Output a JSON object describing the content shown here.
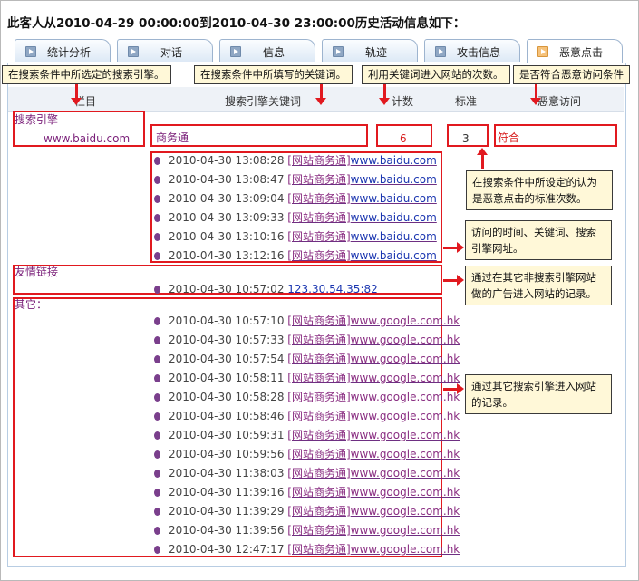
{
  "header": {
    "title": "此客人从2010-04-29 00:00:00到2010-04-30 23:00:00历史活动信息如下："
  },
  "tabs": [
    {
      "label": "统计分析"
    },
    {
      "label": "对话"
    },
    {
      "label": "信息"
    },
    {
      "label": "轨迹"
    },
    {
      "label": "攻击信息"
    },
    {
      "label": "恶意点击",
      "active": true
    }
  ],
  "columns": {
    "c1": "栏目",
    "c2": "搜索引擎关键词",
    "c3": "计数",
    "c4": "标准",
    "c5": "恶意访问"
  },
  "annotations": {
    "engine": "在搜索条件中所选定的搜索引擎。",
    "keyword": "在搜索条件中所填写的关键词。",
    "count": "利用关键词进入网站的次数。",
    "malicious": "是否符合恶意访问条件",
    "standard": "在搜索条件中所设定的认为是恶意点击的标准次数。",
    "visits": "访问的时间、关键词、搜索引擎网址。",
    "friend": "通过在其它非搜索引擎网站做的广告进入网站的记录。",
    "other": "通过其它搜索引擎进入网站的记录。"
  },
  "search_section": {
    "label": "搜索引擎",
    "engine": "www.baidu.com",
    "keyword": "商务通",
    "count": "6",
    "standard": "3",
    "malicious": "符合",
    "records": [
      {
        "time": "2010-04-30 13:08:28",
        "kw": "[网站商务通]",
        "url": "www.baidu.com"
      },
      {
        "time": "2010-04-30 13:08:47",
        "kw": "[网站商务通]",
        "url": "www.baidu.com"
      },
      {
        "time": "2010-04-30 13:09:04",
        "kw": "[网站商务通]",
        "url": "www.baidu.com"
      },
      {
        "time": "2010-04-30 13:09:33",
        "kw": "[网站商务通]",
        "url": "www.baidu.com"
      },
      {
        "time": "2010-04-30 13:10:16",
        "kw": "[网站商务通]",
        "url": "www.baidu.com"
      },
      {
        "time": "2010-04-30 13:12:16",
        "kw": "[网站商务通]",
        "url": "www.baidu.com"
      }
    ]
  },
  "friend_section": {
    "label": "友情链接",
    "records": [
      {
        "time": "2010-04-30 10:57:02",
        "url": "123.30.54.35:82"
      }
    ]
  },
  "other_section": {
    "label": "其它：",
    "records": [
      {
        "time": "2010-04-30 10:57:10",
        "kw": "[网站商务通]",
        "url": "www.google.com.hk"
      },
      {
        "time": "2010-04-30 10:57:33",
        "kw": "[网站商务通]",
        "url": "www.google.com.hk"
      },
      {
        "time": "2010-04-30 10:57:54",
        "kw": "[网站商务通]",
        "url": "www.google.com.hk"
      },
      {
        "time": "2010-04-30 10:58:11",
        "kw": "[网站商务通]",
        "url": "www.google.com.hk"
      },
      {
        "time": "2010-04-30 10:58:28",
        "kw": "[网站商务通]",
        "url": "www.google.com.hk"
      },
      {
        "time": "2010-04-30 10:58:46",
        "kw": "[网站商务通]",
        "url": "www.google.com.hk"
      },
      {
        "time": "2010-04-30 10:59:31",
        "kw": "[网站商务通]",
        "url": "www.google.com.hk"
      },
      {
        "time": "2010-04-30 10:59:56",
        "kw": "[网站商务通]",
        "url": "www.google.com.hk"
      },
      {
        "time": "2010-04-30 11:38:03",
        "kw": "[网站商务通]",
        "url": "www.google.com.hk"
      },
      {
        "time": "2010-04-30 11:39:16",
        "kw": "[网站商务通]",
        "url": "www.google.com.hk"
      },
      {
        "time": "2010-04-30 11:39:29",
        "kw": "[网站商务通]",
        "url": "www.google.com.hk"
      },
      {
        "time": "2010-04-30 11:39:56",
        "kw": "[网站商务通]",
        "url": "www.google.com.hk"
      },
      {
        "time": "2010-04-30 12:47:17",
        "kw": "[网站商务通]",
        "url": "www.google.com.hk"
      }
    ]
  },
  "colors": {
    "annotation_red": "#e1191f",
    "link_purple": "#7a1f79",
    "tip_bg": "#fff8d8"
  }
}
